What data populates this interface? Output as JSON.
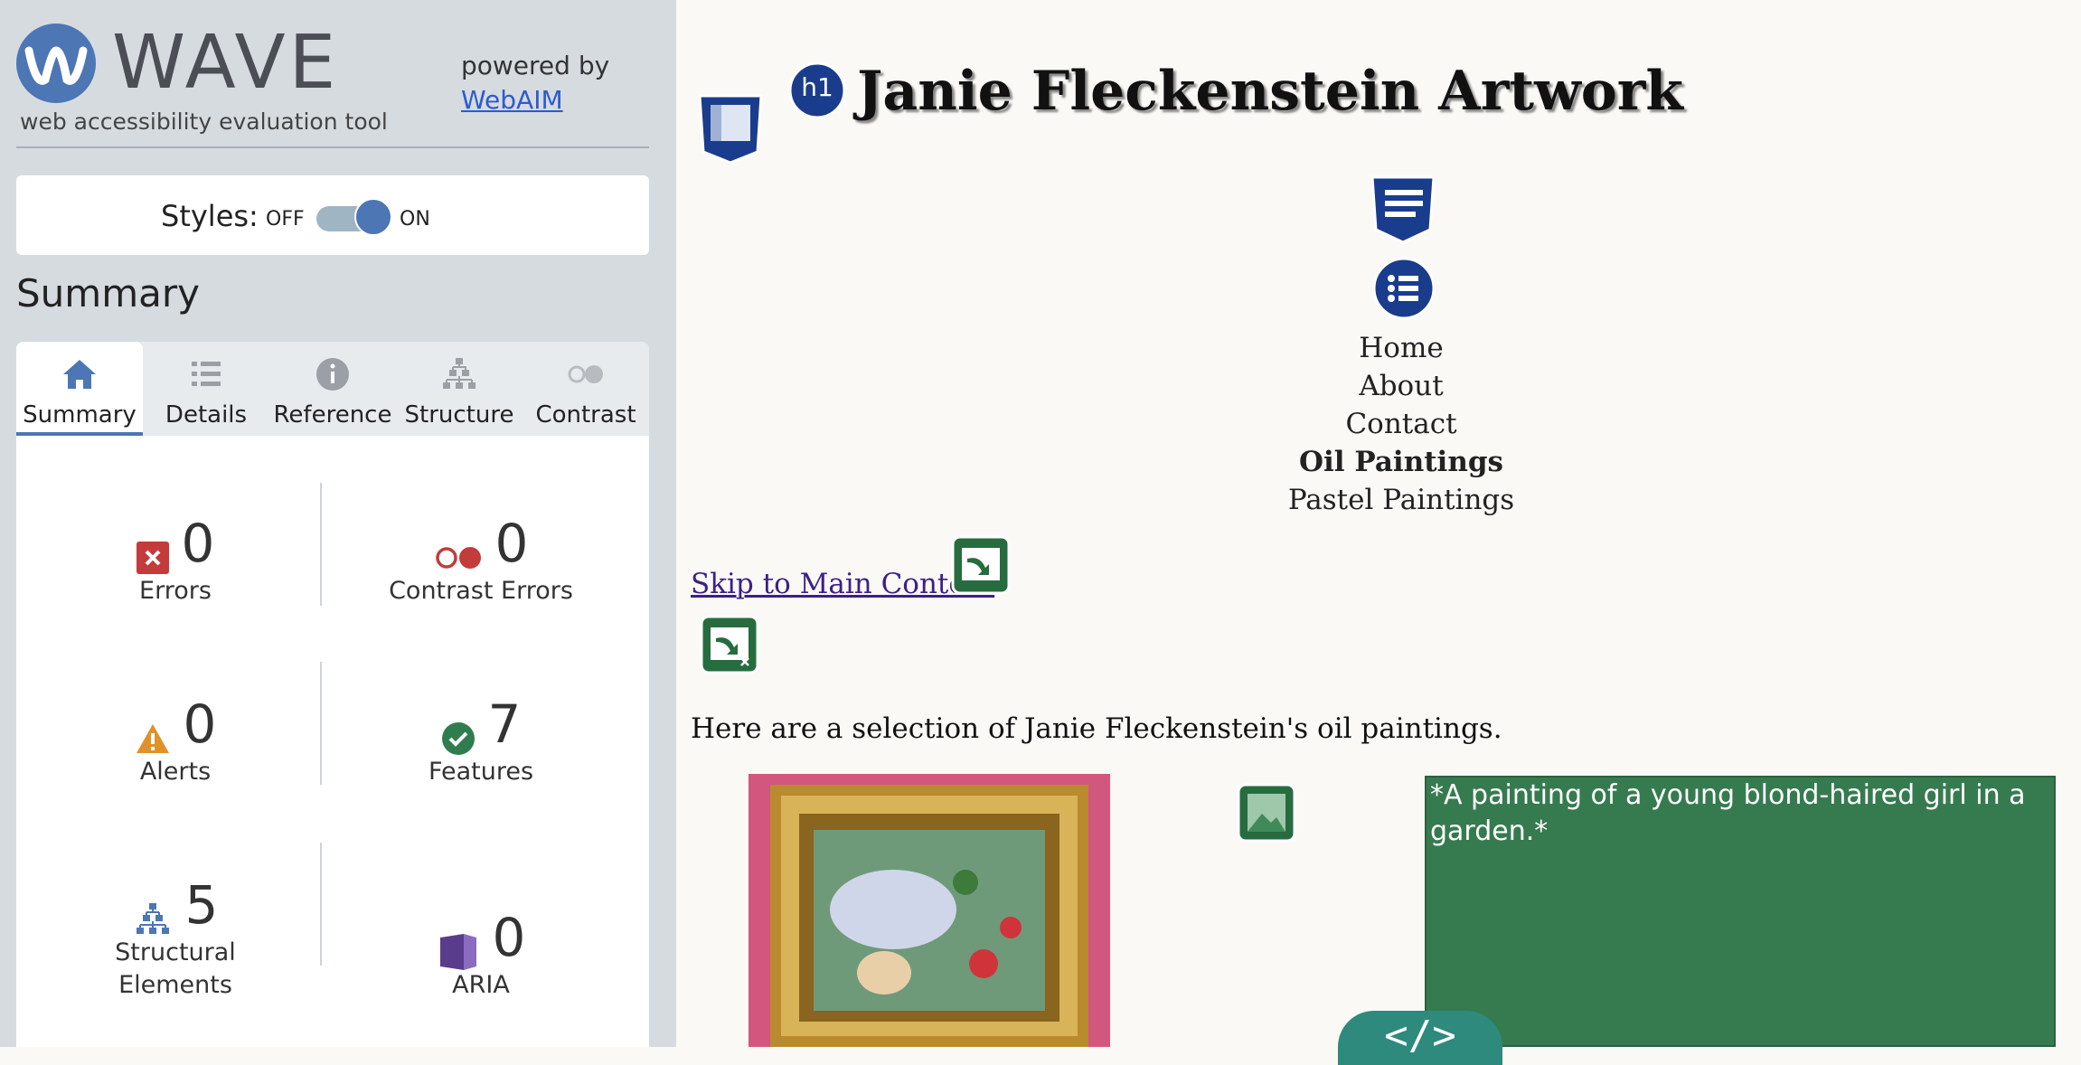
{
  "wave": {
    "brand": "WAVE",
    "subtitle": "web accessibility evaluation tool",
    "powered_by": "powered by",
    "webaim_link": "WebAIM",
    "styles_label": "Styles:",
    "styles_off": "OFF",
    "styles_on": "ON",
    "summary_heading": "Summary",
    "tabs": [
      {
        "label": "Summary",
        "icon": "home-icon",
        "active": true
      },
      {
        "label": "Details",
        "icon": "list-icon"
      },
      {
        "label": "Reference",
        "icon": "info-icon"
      },
      {
        "label": "Structure",
        "icon": "hierarchy-icon"
      },
      {
        "label": "Contrast",
        "icon": "contrast-icon"
      }
    ],
    "stats": {
      "errors": {
        "count": "0",
        "label": "Errors",
        "color": "#c33b3b"
      },
      "contrast_errors": {
        "count": "0",
        "label": "Contrast Errors",
        "color": "#c33b3b"
      },
      "alerts": {
        "count": "0",
        "label": "Alerts",
        "color": "#e0922a"
      },
      "features": {
        "count": "7",
        "label": "Features",
        "color": "#2f7d4f"
      },
      "structural": {
        "count": "5",
        "label_line1": "Structural",
        "label_line2": "Elements",
        "color": "#4c76b4"
      },
      "aria": {
        "count": "0",
        "label": "ARIA",
        "color": "#5a3c8c"
      }
    }
  },
  "page": {
    "h1_badge": "h1",
    "title": "Janie Fleckenstein Artwork",
    "nav": [
      "Home",
      "About",
      "Contact",
      "Oil Paintings",
      "Pastel Paintings"
    ],
    "nav_current": "Oil Paintings",
    "skip_link": "Skip to Main Content",
    "intro": "Here are a selection of Janie Fleckenstein's oil paintings.",
    "alt_text": "*A painting of a young blond-haired girl in a garden.*"
  }
}
